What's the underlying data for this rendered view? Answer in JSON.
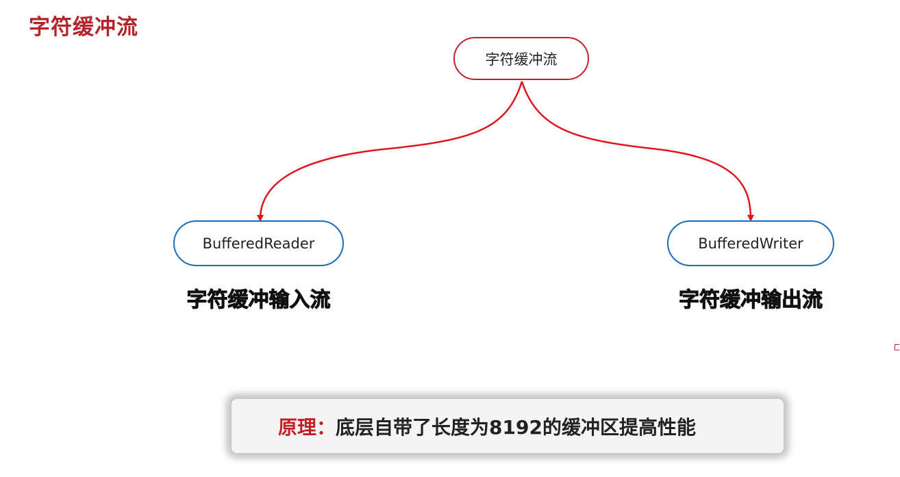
{
  "page": {
    "title": "字符缓冲流"
  },
  "diagram": {
    "root": {
      "label": "字符缓冲流"
    },
    "children": [
      {
        "label": "BufferedReader",
        "caption": "字符缓冲输入流"
      },
      {
        "label": "BufferedWriter",
        "caption": "字符缓冲输出流"
      }
    ]
  },
  "note": {
    "label": "原理：",
    "text": "底层自带了长度为8192的缓冲区提高性能"
  },
  "colors": {
    "title": "#b5232a",
    "root_border": "#c21f28",
    "arrow": "#e0141e",
    "child_border": "#1a6db8"
  }
}
